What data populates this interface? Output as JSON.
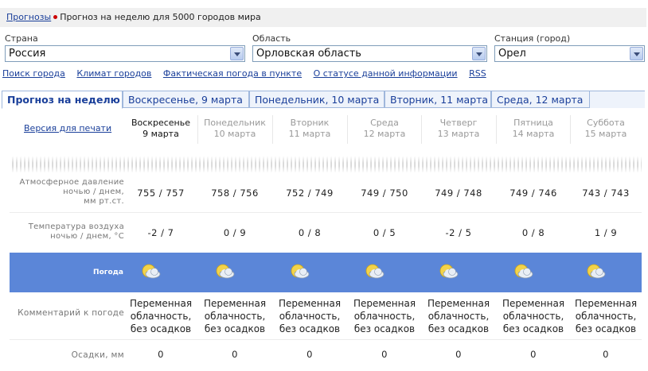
{
  "breadcrumb": {
    "link": "Прогнозы",
    "current": "Прогноз на неделю для 5000 городов мира"
  },
  "selectors": {
    "country": {
      "label": "Страна",
      "value": "Россия"
    },
    "region": {
      "label": "Область",
      "value": "Орловская область"
    },
    "station": {
      "label": "Станция (город)",
      "value": "Орел"
    }
  },
  "links": [
    "Поиск города",
    "Климат городов",
    "Фактическая погода в пункте",
    "О статусе данной информации",
    "RSS"
  ],
  "tabs": [
    "Прогноз на неделю",
    "Воскресенье, 9 марта",
    "Понедельник, 10 марта",
    "Вторник, 11 марта",
    "Среда, 12 марта"
  ],
  "print_link": "Версия для печати",
  "days": [
    {
      "name": "Воскресенье",
      "date": "9 марта"
    },
    {
      "name": "Понедельник",
      "date": "10 марта"
    },
    {
      "name": "Вторник",
      "date": "11 марта"
    },
    {
      "name": "Среда",
      "date": "12 марта"
    },
    {
      "name": "Четверг",
      "date": "13 марта"
    },
    {
      "name": "Пятница",
      "date": "14 марта"
    },
    {
      "name": "Суббота",
      "date": "15 марта"
    }
  ],
  "rows": {
    "pressure": {
      "label": [
        "Атмосферное давление",
        "ночью / днем,",
        "мм рт.ст."
      ],
      "values": [
        "755 / 757",
        "758 / 756",
        "752 / 749",
        "749 / 750",
        "749 / 748",
        "749 / 746",
        "743 / 743"
      ]
    },
    "temperature": {
      "label": [
        "Температура воздуха",
        "ночью / днем, °С"
      ],
      "values": [
        "-2 / 7",
        "0 / 9",
        "0 / 8",
        "0 / 5",
        "-2 / 5",
        "0 / 8",
        "1 / 9"
      ]
    },
    "weather": {
      "label": "Погода",
      "icon": "partly-cloudy-icon"
    },
    "comment": {
      "label": "Комментарий к погоде",
      "values": [
        [
          "Переменная",
          "облачность,",
          "без осадков"
        ],
        [
          "Переменная",
          "облачность,",
          "без осадков"
        ],
        [
          "Переменная",
          "облачность,",
          "без осадков"
        ],
        [
          "Переменная",
          "облачность,",
          "без осадков"
        ],
        [
          "Переменная",
          "облачность,",
          "без осадков"
        ],
        [
          "Переменная",
          "облачность,",
          "без осадков"
        ],
        [
          "Переменная",
          "облачность,",
          "без осадков"
        ]
      ]
    },
    "precip": {
      "label": "Осадки, мм",
      "values": [
        "0",
        "0",
        "0",
        "0",
        "0",
        "0",
        "0"
      ]
    }
  },
  "colors": {
    "link": "#1a3f9a",
    "weather_band": "#5b86d8",
    "breadcrumb_dot": "#cc0000"
  }
}
